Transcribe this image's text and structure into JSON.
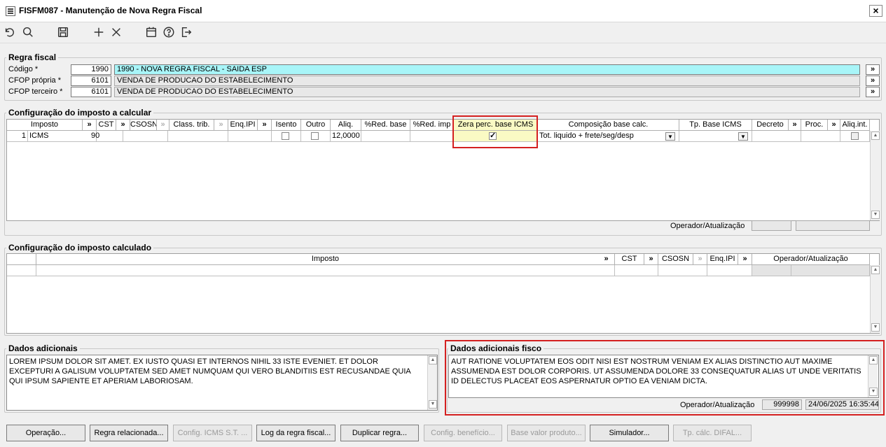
{
  "window": {
    "title": "FISFM087 - Manutenção de Nova Regra Fiscal",
    "close_label": "×"
  },
  "toolbar": {
    "icons": [
      "undo-icon",
      "search-icon",
      "save-icon",
      "add-icon",
      "close-icon",
      "calendar-icon",
      "help-icon",
      "exit-icon"
    ]
  },
  "regra_fiscal": {
    "legend": "Regra fiscal",
    "codigo": {
      "label": "Código *",
      "value": "1990",
      "desc": "1990 - NOVA REGRA FISCAL - SAIDA ESP"
    },
    "cfop_propria": {
      "label": "CFOP própria *",
      "value": "6101",
      "desc": "VENDA DE PRODUCAO DO ESTABELECIMENTO"
    },
    "cfop_terceiro": {
      "label": "CFOP terceiro *",
      "value": "6101",
      "desc": "VENDA DE PRODUCAO DO ESTABELECIMENTO"
    },
    "more_label": "»"
  },
  "config_calcular": {
    "legend": "Configuração do imposto a calcular",
    "headers": {
      "imposto": "Imposto",
      "cst": "CST",
      "csosn": "CSOSN",
      "class_trib": "Class. trib.",
      "enq_ipi": "Enq.IPI",
      "isento": "Isento",
      "outro": "Outro",
      "aliq": "Aliq.",
      "red_base": "%Red. base",
      "red_imp": "%Red. imp",
      "zera": "Zera perc. base ICMS",
      "composicao": "Composição base calc.",
      "tp_base": "Tp. Base ICMS",
      "decreto": "Decreto",
      "proc": "Proc.",
      "aliq_int": "Aliq.int.",
      "more": "»"
    },
    "row": {
      "num": "1",
      "imposto": "ICMS",
      "cst": "90",
      "aliq": "12,0000",
      "composicao": "Tot. liquido + frete/seg/desp",
      "isento": false,
      "outro": false,
      "zera": true,
      "aliq_int": false
    },
    "operador_label": "Operador/Atualização"
  },
  "config_calculado": {
    "legend": "Configuração do imposto calculado",
    "headers": {
      "imposto": "Imposto",
      "cst": "CST",
      "csosn": "CSOSN",
      "enq_ipi": "Enq.IPI",
      "operador": "Operador/Atualização",
      "more": "»"
    }
  },
  "dados_adicionais": {
    "legend": "Dados adicionais",
    "text": "LOREM IPSUM DOLOR SIT AMET. EX IUSTO QUASI ET INTERNOS NIHIL 33 ISTE EVENIET. ET DOLOR EXCEPTURI A GALISUM VOLUPTATEM SED AMET NUMQUAM QUI VERO BLANDITIIS EST RECUSANDAE QUIA QUI IPSUM SAPIENTE ET APERIAM LABORIOSAM."
  },
  "dados_fisco": {
    "legend": "Dados adicionais fisco",
    "text": "AUT RATIONE VOLUPTATEM EOS ODIT NISI EST NOSTRUM VENIAM EX ALIAS DISTINCTIO AUT MAXIME ASSUMENDA EST DOLOR CORPORIS. UT ASSUMENDA DOLORE 33 CONSEQUATUR ALIAS UT UNDE VERITATIS ID DELECTUS PLACEAT EOS ASPERNATUR OPTIO EA VENIAM DICTA.",
    "operador_label": "Operador/Atualização",
    "operador": "999998",
    "atualizacao": "24/06/2025 16:35:44"
  },
  "buttons": {
    "operacao": "Operação...",
    "regra_relacionada": "Regra relacionada...",
    "config_icms_st": "Config. ICMS S.T. ...",
    "log_regra": "Log da regra fiscal...",
    "duplicar": "Duplicar regra...",
    "config_beneficio": "Config. benefício...",
    "base_valor": "Base valor produto...",
    "simulador": "Simulador...",
    "tp_calc_difal": "Tp. cálc. DIFAL..."
  }
}
